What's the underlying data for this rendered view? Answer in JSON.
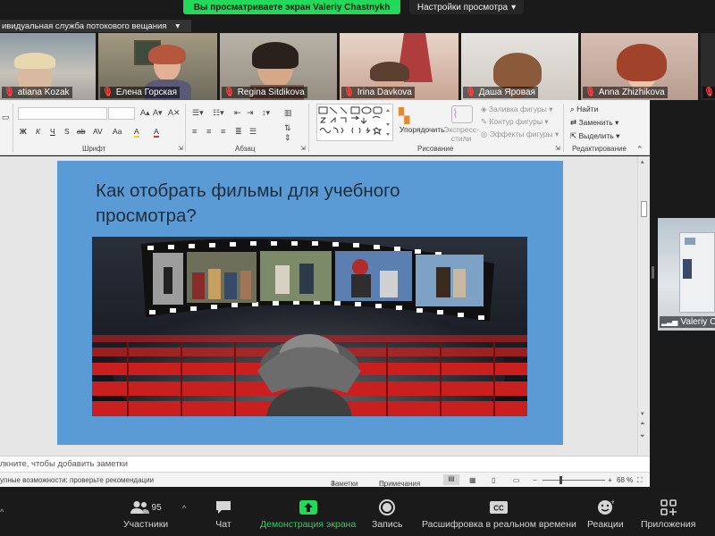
{
  "share_banner": {
    "text": "Вы просматриваете экран Valeriy Chastnykh",
    "view_options": "Настройки просмотра"
  },
  "streaming": {
    "text": "ивидуальная служба потокового вещания"
  },
  "participants": [
    {
      "name": "atiana Kozak"
    },
    {
      "name": "Елена Горская"
    },
    {
      "name": "Regina Sitdikova"
    },
    {
      "name": "Irina Davkova"
    },
    {
      "name": "Даша Яровая"
    },
    {
      "name": "Anna Zhizhikova"
    }
  ],
  "ribbon": {
    "font_group": "Шрифт",
    "paragraph_group": "Абзац",
    "drawing_group": "Рисование",
    "editing_group": "Редактирование",
    "arrange": "Упорядочить",
    "quick_styles": "Экспресс-стили",
    "shape_fill": "Заливка фигуры",
    "shape_outline": "Контур фигуры",
    "shape_effects": "Эффекты фигуры",
    "find": "Найти",
    "replace": "Заменить",
    "select": "Выделить",
    "format_buttons": [
      "Ж",
      "К",
      "Ч",
      "S",
      "ab",
      "AV",
      "Aa",
      "A",
      "A"
    ]
  },
  "slide": {
    "title": "Как отобрать фильмы для учебного просмотра?"
  },
  "notes": {
    "placeholder": "лкните, чтобы добавить заметки"
  },
  "status": {
    "accessibility": "упные возможности: проверьте рекомендации",
    "notes": "Заметки",
    "comments": "Примечания",
    "zoom": "68 %"
  },
  "right_video": {
    "name": "Valeriy Ch"
  },
  "toolbar": {
    "participants_label": "Участники",
    "participants_count": "95",
    "chat": "Чат",
    "share": "Демонстрация экрана",
    "record": "Запись",
    "captions": "Расшифровка в реальном времени",
    "reactions": "Реакции",
    "apps": "Приложения"
  },
  "colors": {
    "zoom_green": "#23d959",
    "slide_blue": "#5b9bd5",
    "toolbar_bg": "#1a1a1a",
    "mic_off": "#ff4040"
  }
}
